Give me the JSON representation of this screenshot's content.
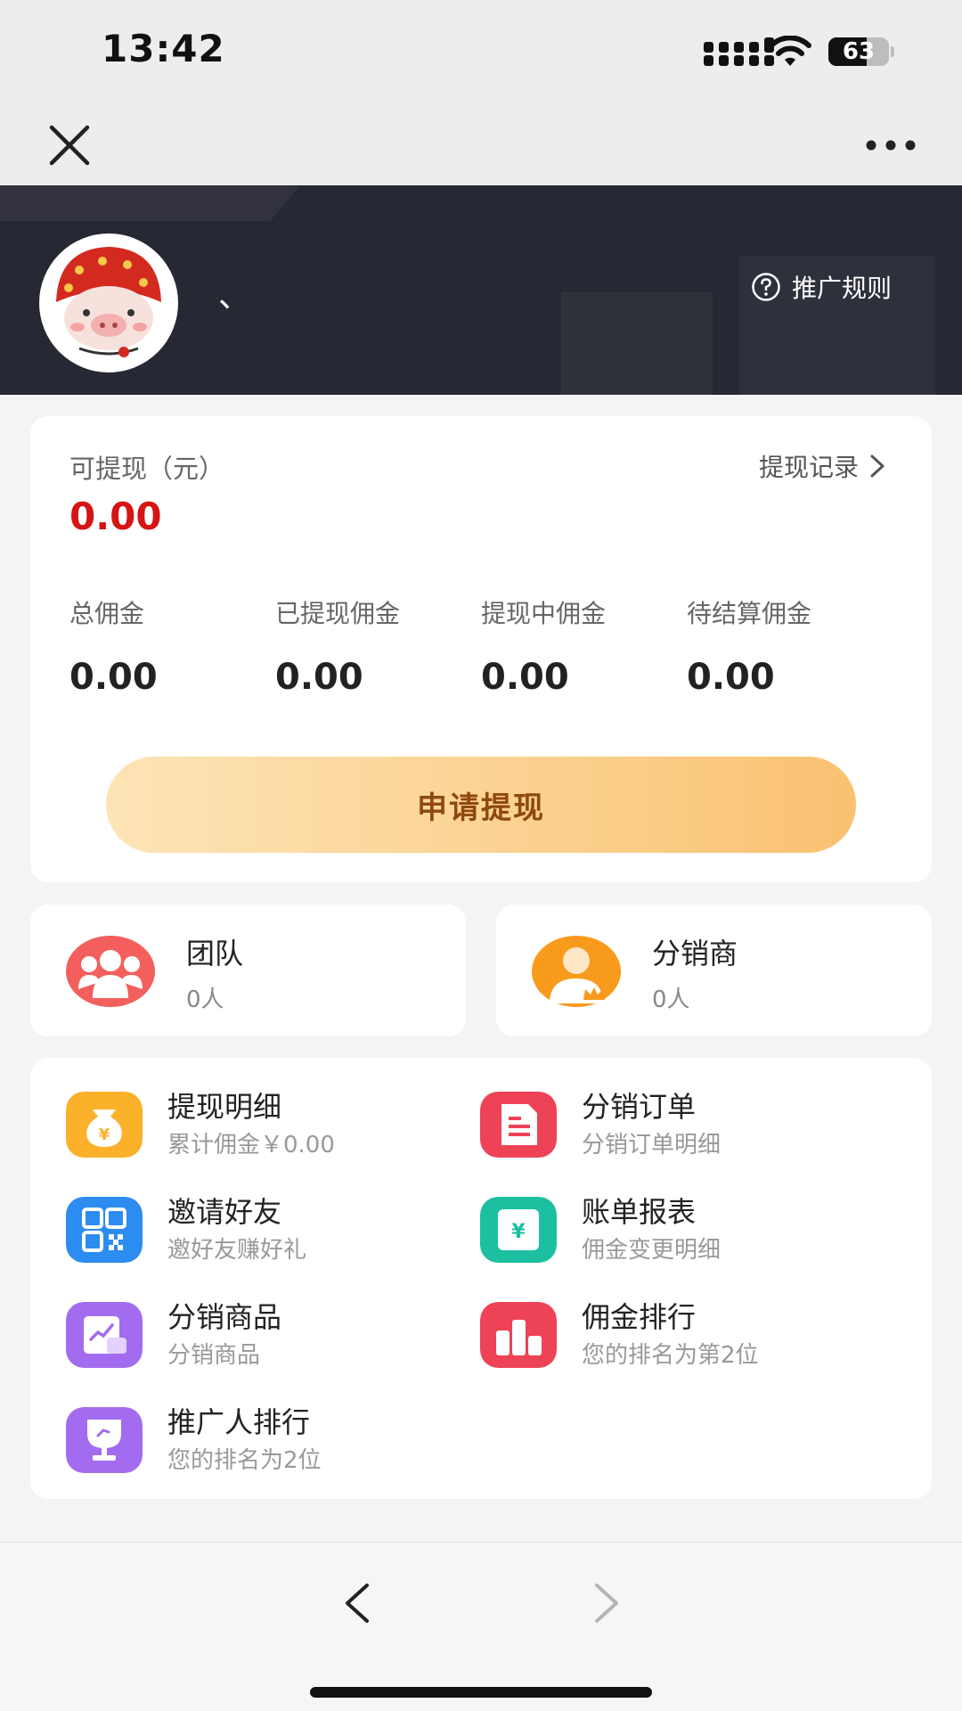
{
  "status_bar": {
    "time": "13:42",
    "battery": "63",
    "battery_level": 0.63
  },
  "nav": {
    "close_icon": "close-icon",
    "more_icon": "more-icon"
  },
  "header": {
    "username": "、",
    "rules_label": "推广规则",
    "rules_icon": "question-circle-icon"
  },
  "balance": {
    "label": "可提现（元）",
    "value": "0.00",
    "record_label": "提现记录",
    "stats": [
      {
        "label": "总佣金",
        "value": "0.00"
      },
      {
        "label": "已提现佣金",
        "value": "0.00"
      },
      {
        "label": "提现中佣金",
        "value": "0.00"
      },
      {
        "label": "待结算佣金",
        "value": "0.00"
      }
    ],
    "apply_label": "申请提现"
  },
  "team": {
    "title": "团队",
    "count": "0人",
    "icon": "team-icon",
    "color": "#f25f5c"
  },
  "distributor": {
    "title": "分销商",
    "count": "0人",
    "icon": "distributor-icon",
    "color": "#f89a1c"
  },
  "menu": [
    {
      "title": "提现明细",
      "sub": "累计佣金￥0.00",
      "icon": "money-bag-icon",
      "color": "#fbb12a"
    },
    {
      "title": "分销订单",
      "sub": "分销订单明细",
      "icon": "order-icon",
      "color": "#ee4257"
    },
    {
      "title": "邀请好友",
      "sub": "邀好友赚好礼",
      "icon": "qrcode-icon",
      "color": "#2d8cf0"
    },
    {
      "title": "账单报表",
      "sub": "佣金变更明细",
      "icon": "bill-icon",
      "color": "#1cc0a0"
    },
    {
      "title": "分销商品",
      "sub": "分销商品",
      "icon": "product-icon",
      "color": "#a36cf0"
    },
    {
      "title": "佣金排行",
      "sub": "您的排名为第2位",
      "icon": "ranking-icon",
      "color": "#ee4257"
    },
    {
      "title": "推广人排行",
      "sub": "您的排名为2位",
      "icon": "trophy-icon",
      "color": "#a36cf0"
    }
  ],
  "bottom_nav": {
    "back_icon": "chevron-left-icon",
    "forward_icon": "chevron-right-icon"
  }
}
